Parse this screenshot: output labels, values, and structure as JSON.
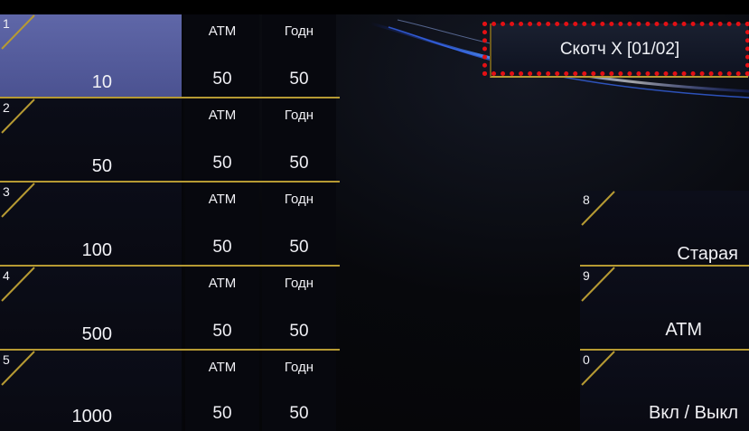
{
  "title": "Скотч X [01/02]",
  "columns": {
    "atm": "АТМ",
    "good": "Годн"
  },
  "rows": [
    {
      "num": "1",
      "value": "10",
      "atm": "50",
      "good": "50",
      "selected": true
    },
    {
      "num": "2",
      "value": "50",
      "atm": "50",
      "good": "50",
      "selected": false
    },
    {
      "num": "3",
      "value": "100",
      "atm": "50",
      "good": "50",
      "selected": false
    },
    {
      "num": "4",
      "value": "500",
      "atm": "50",
      "good": "50",
      "selected": false
    },
    {
      "num": "5",
      "value": "1000",
      "atm": "50",
      "good": "50",
      "selected": false
    }
  ],
  "side_buttons": [
    {
      "num": "8",
      "label": "Старая"
    },
    {
      "num": "9",
      "label": "АТМ"
    },
    {
      "num": "0",
      "label": "Вкл / Выкл"
    }
  ],
  "colors": {
    "accent_gold": "#b69a33",
    "selected_bg": "#5a61a3",
    "highlight_red": "#e31014"
  }
}
